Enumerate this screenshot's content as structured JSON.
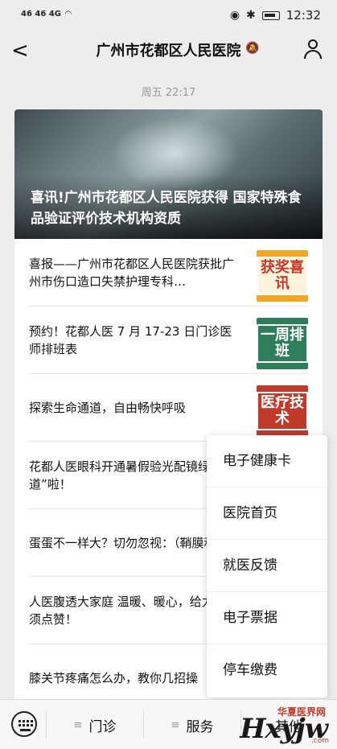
{
  "status": {
    "carrier_left": "46 46 4G",
    "time": "12:32"
  },
  "header": {
    "back_glyph": "<",
    "title": "广州市花都区人民医院"
  },
  "timestamp": "周五 22:17",
  "hero": {
    "headline": "喜讯!广州市花都区人民医院获得 国家特殊食品验证评价技术机构资质"
  },
  "articles": [
    {
      "text": "喜报——广州市花都区人民医院获批广州市伤口造口失禁护理专科…",
      "thumb": "获奖喜讯"
    },
    {
      "text": "预约！花都人医 7 月 17-23 日门诊医师排班表",
      "thumb": "一周排班"
    },
    {
      "text": "探索生命通道，自由畅快呼吸",
      "thumb": "医疗技术"
    },
    {
      "text": "花都人医眼科开通暑假验光配镜绿色通道”啦！",
      "thumb": ""
    },
    {
      "text": "蛋蛋不一样大？切勿忽视：（鞘膜积液",
      "thumb": ""
    },
    {
      "text": "人医腹透大家庭 温暖、暖心，给力！必须点赞！",
      "thumb": ""
    },
    {
      "text": "膝关节疼痛怎么办，教你几招操",
      "thumb": ""
    }
  ],
  "popup_menu": [
    {
      "label": "电子健康卡"
    },
    {
      "label": "医院首页"
    },
    {
      "label": "就医反馈"
    },
    {
      "label": "电子票据"
    },
    {
      "label": "停车缴费"
    }
  ],
  "bottom_tabs": [
    {
      "label": "门诊"
    },
    {
      "label": "服务"
    },
    {
      "label": "其他"
    }
  ],
  "watermark": {
    "top": "华夏医界网",
    "big": "Hxyjw",
    "suffix": ".com"
  }
}
